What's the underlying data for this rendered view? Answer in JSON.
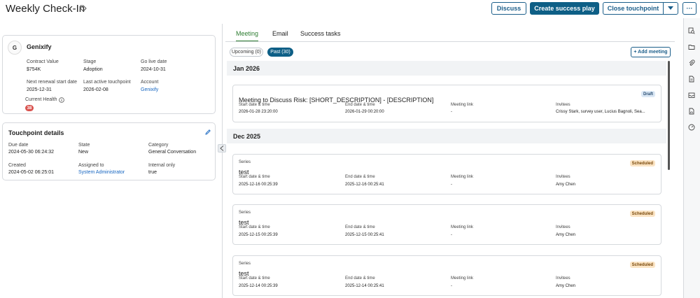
{
  "header": {
    "title": "Weekly Check-In",
    "discuss_label": "Discuss",
    "create_label": "Create success play",
    "close_label": "Close touchpoint",
    "more_label": "···"
  },
  "account": {
    "logo_text": "G",
    "name": "Genixify",
    "contract_value_label": "Contract Value",
    "contract_value": "$754K",
    "stage_label": "Stage",
    "stage": "Adoption",
    "go_live_label": "Go live date",
    "go_live": "2024-10-31",
    "renewal_label": "Next renewal start date",
    "renewal": "2025-12-31",
    "last_touch_label": "Last active touchpoint",
    "last_touch": "2026-02-08",
    "account_label": "Account",
    "account_link": "Genixify",
    "health_label": "Current Health",
    "health_value": "38"
  },
  "touchpoint": {
    "title": "Touchpoint details",
    "due_label": "Due date",
    "due": "2024-05-30 06:24:32",
    "state_label": "State",
    "state": "New",
    "category_label": "Category",
    "category": "General Conversation",
    "created_label": "Created",
    "created": "2024-05-02 06:25:01",
    "assigned_label": "Assigned to",
    "assigned": "System Administrator",
    "internal_label": "Internal only",
    "internal": "true"
  },
  "tabs": [
    "Meeting",
    "Email",
    "Success tasks"
  ],
  "filters": {
    "upcoming": "Upcoming (0)",
    "past": "Past (30)",
    "add_meeting": "+ Add meeting"
  },
  "months": [
    "Jan 2026",
    "Dec 2025"
  ],
  "col_labels": {
    "start": "Start date & time",
    "end": "End date & time",
    "link": "Meeting link",
    "invitees": "Invitees"
  },
  "meetings": [
    {
      "series": "",
      "title": "Meeting to Discuss Risk: [SHORT_DESCRIPTION] - [DESCRIPTION]",
      "badge": "Draft",
      "start": "2026-01-28 23:20:00",
      "end": "2026-01-29 00:20:00",
      "link": "-",
      "invitees": "Crissy Stark, survey user, Lucius Bagnoli, Sea..."
    },
    {
      "series": "Series",
      "title": "test",
      "badge": "Scheduled",
      "start": "2025-12-16 00:25:39",
      "end": "2025-12-16 00:25:41",
      "link": "-",
      "invitees": "Amy Chen"
    },
    {
      "series": "Series",
      "title": "test",
      "badge": "Scheduled",
      "start": "2025-12-15 00:25:39",
      "end": "2025-12-15 00:25:41",
      "link": "-",
      "invitees": "Amy Chen"
    },
    {
      "series": "Series",
      "title": "test",
      "badge": "Scheduled",
      "start": "2025-12-14 00:25:39",
      "end": "2025-12-14 00:25:41",
      "link": "-",
      "invitees": "Amy Chen"
    }
  ],
  "colors": {
    "primary": "#0e5f86",
    "active_tab": "#2e7d32",
    "health": "#d9534f",
    "draft_bg": "#dbe8f5",
    "scheduled_bg": "#fbe4c4"
  },
  "sidebar_icons": [
    "search-detail-icon",
    "folder-icon",
    "paperclip-icon",
    "document-icon",
    "inbox-icon",
    "file-chart-icon",
    "dashboard-icon"
  ]
}
